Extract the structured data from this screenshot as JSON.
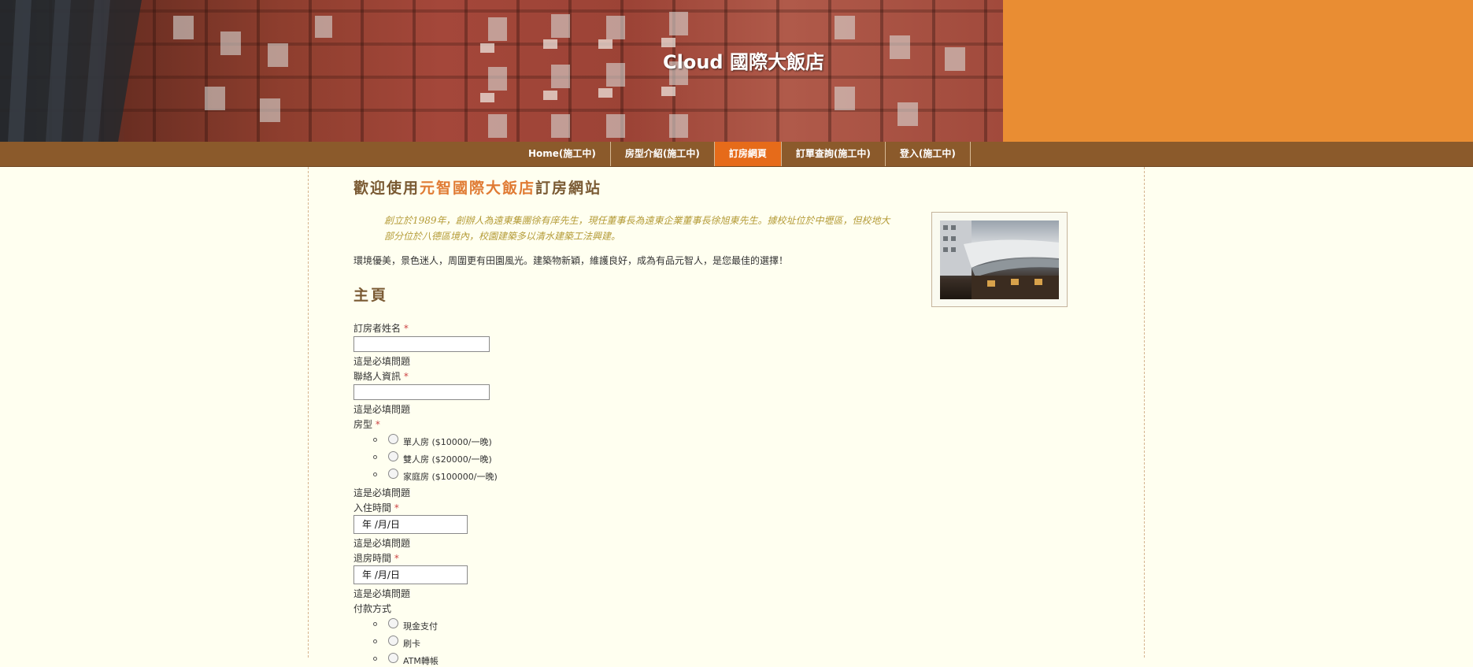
{
  "header": {
    "site_title": "Cloud 國際大飯店"
  },
  "nav": {
    "items": [
      {
        "label": "Home(施工中)"
      },
      {
        "label": "房型介紹(施工中)"
      },
      {
        "label": "訂房網頁"
      },
      {
        "label": "訂單查詢(施工中)"
      },
      {
        "label": "登入(施工中)"
      }
    ],
    "active_index": 2
  },
  "main": {
    "welcome_prefix": "歡迎使用",
    "welcome_highlight": "元智國際大飯店",
    "welcome_suffix": "訂房網站",
    "intro": "創立於1989年，創辦人為遠東集團徐有庠先生，現任董事長為遠東企業董事長徐旭東先生。據校址位於中壢區，但校地大部分位於八德區境內，校園建築多以清水建築工法興建。",
    "description": "環境優美，景色迷人，周圍更有田園風光。建築物新穎，維護良好，成為有品元智人，是您最佳的選擇！",
    "section_title": "主頁"
  },
  "form": {
    "required_message": "這是必填問題",
    "name_label": "訂房者姓名",
    "contact_label": "聯絡人資訊",
    "room_type_label": "房型",
    "room_options": [
      {
        "label": "單人房 ($10000/一晚)"
      },
      {
        "label": "雙人房 ($20000/一晚)"
      },
      {
        "label": "家庭房 ($100000/一晚)"
      }
    ],
    "checkin_label": "入住時間",
    "checkout_label": "退房時間",
    "date_placeholder": "年 /月/日",
    "payment_label": "付款方式",
    "payment_options": [
      {
        "label": "現金支付"
      },
      {
        "label": "刷卡"
      },
      {
        "label": "ATM轉帳"
      }
    ],
    "required_mark": "*"
  },
  "colors": {
    "nav_bg": "#8b5a2b",
    "nav_active": "#e66b1a",
    "header_orange": "#e98d33",
    "page_bg": "#fffff0",
    "title_brown": "#7a5a33",
    "highlight_orange": "#e07b34",
    "intro_gold": "#b49b37"
  }
}
